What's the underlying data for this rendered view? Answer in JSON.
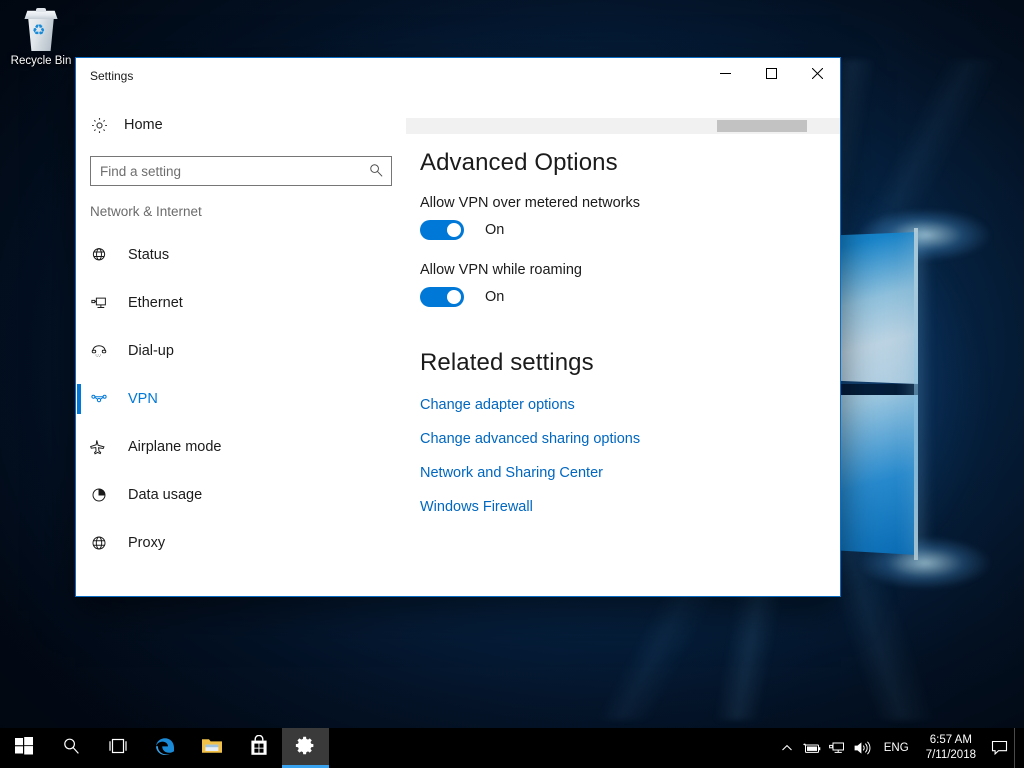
{
  "desktop": {
    "recycle_bin": {
      "label": "Recycle Bin",
      "icon": "recycle-bin-icon"
    }
  },
  "window": {
    "title": "Settings",
    "controls": {
      "minimize": "Minimize",
      "maximize": "Maximize",
      "close": "Close"
    }
  },
  "sidebar": {
    "home": {
      "label": "Home",
      "icon": "gear-icon"
    },
    "search": {
      "placeholder": "Find a setting",
      "value": "",
      "icon": "search-icon"
    },
    "group_title": "Network & Internet",
    "items": [
      {
        "label": "Status",
        "icon": "status-globe-icon",
        "selected": false
      },
      {
        "label": "Ethernet",
        "icon": "ethernet-icon",
        "selected": false
      },
      {
        "label": "Dial-up",
        "icon": "dialup-phone-icon",
        "selected": false
      },
      {
        "label": "VPN",
        "icon": "vpn-icon",
        "selected": true
      },
      {
        "label": "Airplane mode",
        "icon": "airplane-icon",
        "selected": false
      },
      {
        "label": "Data usage",
        "icon": "pie-chart-icon",
        "selected": false
      },
      {
        "label": "Proxy",
        "icon": "globe-icon",
        "selected": false
      }
    ]
  },
  "content": {
    "advanced_heading": "Advanced Options",
    "toggles": [
      {
        "caption": "Allow VPN over metered networks",
        "state": "On",
        "on": true
      },
      {
        "caption": "Allow VPN while roaming",
        "state": "On",
        "on": true
      }
    ],
    "related_heading": "Related settings",
    "links": [
      "Change adapter options",
      "Change advanced sharing options",
      "Network and Sharing Center",
      "Windows Firewall"
    ]
  },
  "taskbar": {
    "buttons": [
      {
        "name": "start-button",
        "icon": "windows-logo-icon"
      },
      {
        "name": "search-button",
        "icon": "search-icon"
      },
      {
        "name": "task-view-button",
        "icon": "task-view-icon"
      },
      {
        "name": "edge-button",
        "icon": "edge-icon"
      },
      {
        "name": "file-explorer-button",
        "icon": "folder-icon"
      },
      {
        "name": "microsoft-store-button",
        "icon": "store-bag-icon"
      },
      {
        "name": "settings-button",
        "icon": "gear-icon"
      }
    ],
    "tray": {
      "chevron": "show-hidden-icons-icon",
      "battery": "battery-icon",
      "network": "network-icon",
      "volume": "volume-icon",
      "language": "ENG",
      "time": "6:57 AM",
      "date": "7/11/2018",
      "notifications": "action-center-icon"
    }
  },
  "colors": {
    "accent": "#0078d7",
    "link": "#0067c0",
    "taskbar": "#000000",
    "window_bg": "#ffffff",
    "text": "#1b1b1b"
  }
}
